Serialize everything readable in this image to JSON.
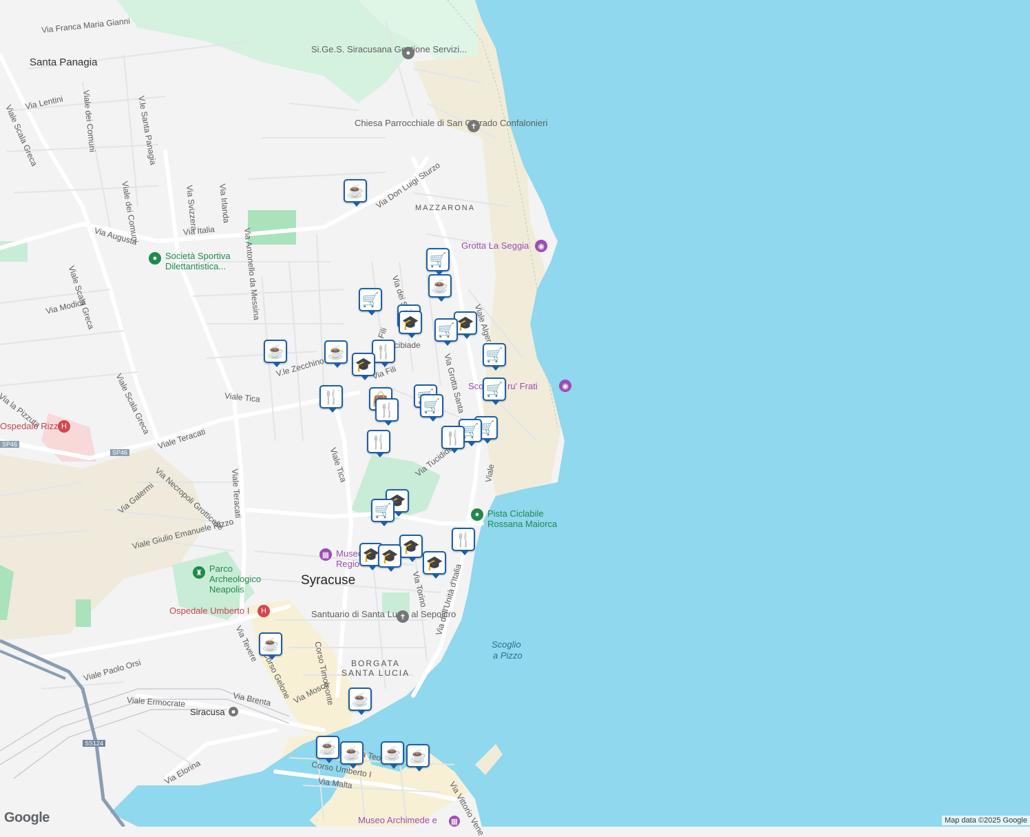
{
  "colors": {
    "sea": "#8fd8ee",
    "land": "#f3f3f3",
    "park": "#c9ecd6",
    "beach": "#f1ecd9",
    "road": "#ffffff",
    "pin_border": "#1a5fa8",
    "highway": "#8a9db3"
  },
  "map": {
    "areas": [
      {
        "text": "Santa Panagia"
      },
      {
        "text": "Syracuse"
      }
    ],
    "districts": [
      {
        "text": "MAZZARONA"
      },
      {
        "text": "BORGATA"
      },
      {
        "text": "SANTA LUCIA"
      }
    ],
    "streets": [
      {
        "text": "Via Franca Maria Gianni"
      },
      {
        "text": "Via Lentini"
      },
      {
        "text": "Viale Scala Greca"
      },
      {
        "text": "Viale dei Comuni"
      },
      {
        "text": "V.le Santa Panagia"
      },
      {
        "text": "Viale dei Comuni"
      },
      {
        "text": "Via Svizzera"
      },
      {
        "text": "Via Irlanda"
      },
      {
        "text": "Via Italia"
      },
      {
        "text": "Via Augusta"
      },
      {
        "text": "Via Don Luigi Sturzo"
      },
      {
        "text": "Via Antonello da Messina"
      },
      {
        "text": "Via Modica"
      },
      {
        "text": "Viale Scala Greca"
      },
      {
        "text": "Viale Scala Greca"
      },
      {
        "text": "V.le Zecchino"
      },
      {
        "text": "Viale Tica"
      },
      {
        "text": "Viale Teracati"
      },
      {
        "text": "Via la Pizzuta"
      },
      {
        "text": "Viale Tica"
      },
      {
        "text": "Via Necropoli Grotticelle"
      },
      {
        "text": "Via Galermi"
      },
      {
        "text": "Viale Teracati"
      },
      {
        "text": "Viale Giulio Emanuele Rizzo"
      },
      {
        "text": "Via dei Sequ"
      },
      {
        "text": "Via Fili"
      },
      {
        "text": "Via Fili"
      },
      {
        "text": "Alcibiade"
      },
      {
        "text": "Via Grotta Santa"
      },
      {
        "text": "Viale Alger"
      },
      {
        "text": "Via Tucidide"
      },
      {
        "text": "Viale"
      },
      {
        "text": "Via Torino"
      },
      {
        "text": "Via dell'Unità d'Italia"
      },
      {
        "text": "Viale Paolo Orsi"
      },
      {
        "text": "Via Tevere"
      },
      {
        "text": "Corso Gelone"
      },
      {
        "text": "Via Mosco"
      },
      {
        "text": "Corso Timoleonte"
      },
      {
        "text": "Via Brenta"
      },
      {
        "text": "Viale Ermocrate"
      },
      {
        "text": "Via Elorina"
      },
      {
        "text": "Corso Umberto I"
      },
      {
        "text": "Via Malta"
      },
      {
        "text": "Via Vittorio Vene"
      },
      {
        "text": "Via Teodoro"
      }
    ],
    "road_shields": [
      {
        "text": "SP46"
      },
      {
        "text": "SP46"
      },
      {
        "text": "SS124"
      }
    ],
    "pois": [
      {
        "text": "Si.Ge.S. Siracusana Gestione Servizi...",
        "icon": "place-icon"
      },
      {
        "text": "Chiesa Parrocchiale di San Corrado Confalonieri",
        "icon": "church-icon"
      },
      {
        "text": "Grotta La Seggia",
        "icon": "camera-icon"
      },
      {
        "text": "Società Sportiva Dilettantistica...",
        "icon": "park-icon"
      },
      {
        "text": "Scoglio e ru' Frati",
        "icon": "camera-icon"
      },
      {
        "text": "Pista Ciclabile Rossana Maiorca",
        "icon": "park-icon"
      },
      {
        "text": "Ospedale Rizza",
        "icon": "hospital-icon"
      },
      {
        "text": "Museo Regio",
        "icon": "museum-icon"
      },
      {
        "text": "Parco Archeologico Neapolis",
        "icon": "monument-icon"
      },
      {
        "text": "Ospedale Umberto I",
        "icon": "hospital-icon"
      },
      {
        "text": "Santuario di Santa Lucia al Sepolcro",
        "icon": "church-icon"
      },
      {
        "text": "Siracusa",
        "icon": "train-icon"
      },
      {
        "text": "Museo Archimede e",
        "icon": "museum-icon"
      }
    ],
    "sea_labels": [
      {
        "text": "Scoglio"
      },
      {
        "text": "a Pizzo"
      }
    ],
    "markers": [
      {
        "type": "cafe",
        "icon": "coffee-cup-icon"
      },
      {
        "type": "shop",
        "icon": "shopping-cart-icon"
      },
      {
        "type": "cafe",
        "icon": "coffee-cup-icon"
      },
      {
        "type": "shop",
        "icon": "shopping-cart-icon"
      },
      {
        "type": "restaurant",
        "icon": "restaurant-icon"
      },
      {
        "type": "school",
        "icon": "graduation-cap-icon"
      },
      {
        "type": "school",
        "icon": "graduation-cap-icon"
      },
      {
        "type": "shop",
        "icon": "shopping-cart-icon"
      },
      {
        "type": "cafe",
        "icon": "coffee-cup-icon"
      },
      {
        "type": "cafe",
        "icon": "coffee-cup-icon"
      },
      {
        "type": "restaurant",
        "icon": "restaurant-icon"
      },
      {
        "type": "school",
        "icon": "graduation-cap-icon"
      },
      {
        "type": "shop",
        "icon": "shopping-cart-icon"
      },
      {
        "type": "shop",
        "icon": "shopping-cart-icon"
      },
      {
        "type": "restaurant",
        "icon": "restaurant-icon"
      },
      {
        "type": "shopping",
        "icon": "shopping-bag-icon"
      },
      {
        "type": "shop",
        "icon": "shopping-cart-icon"
      },
      {
        "type": "shop",
        "icon": "shopping-cart-icon"
      },
      {
        "type": "restaurant",
        "icon": "restaurant-icon"
      },
      {
        "type": "shop",
        "icon": "shopping-cart-icon"
      },
      {
        "type": "shop",
        "icon": "shopping-cart-icon"
      },
      {
        "type": "restaurant",
        "icon": "restaurant-icon"
      },
      {
        "type": "school",
        "icon": "graduation-cap-icon"
      },
      {
        "type": "shop",
        "icon": "shopping-cart-icon"
      },
      {
        "type": "restaurant",
        "icon": "restaurant-icon"
      },
      {
        "type": "school",
        "icon": "graduation-cap-icon"
      },
      {
        "type": "school",
        "icon": "graduation-cap-icon"
      },
      {
        "type": "school",
        "icon": "graduation-cap-icon"
      },
      {
        "type": "school",
        "icon": "graduation-cap-icon"
      },
      {
        "type": "cafe",
        "icon": "coffee-cup-icon"
      },
      {
        "type": "cafe",
        "icon": "coffee-cup-icon"
      },
      {
        "type": "cafe",
        "icon": "coffee-cup-icon"
      },
      {
        "type": "cafe",
        "icon": "coffee-cup-icon"
      },
      {
        "type": "cafe",
        "icon": "coffee-cup-icon"
      },
      {
        "type": "cafe",
        "icon": "coffee-cup-icon"
      }
    ]
  },
  "footer": {
    "logo": "Google",
    "copyright": "Map data ©2025 Google"
  }
}
